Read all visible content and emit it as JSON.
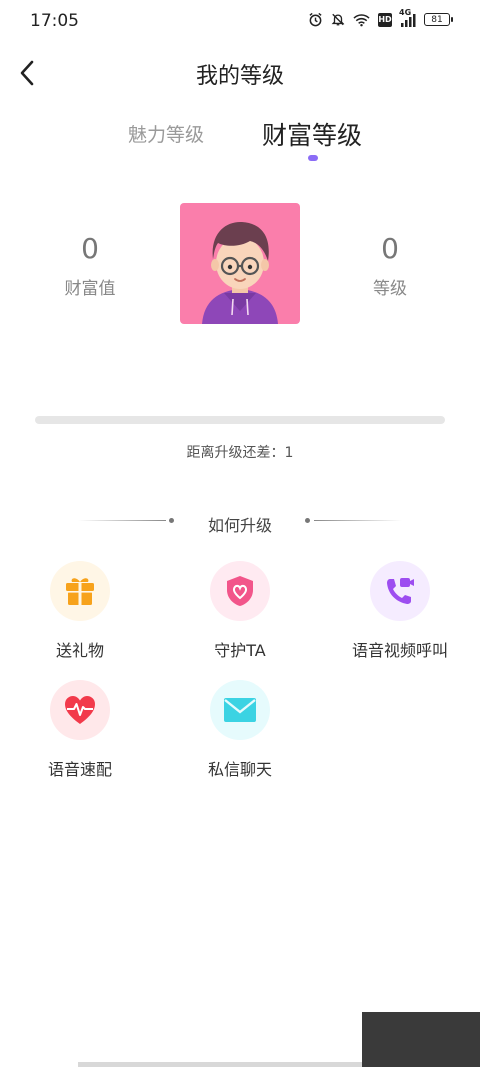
{
  "status_bar": {
    "time": "17:05",
    "network": "4G",
    "hd": "HD",
    "battery": "81"
  },
  "header": {
    "title": "我的等级",
    "back_icon": "chevron-left-icon"
  },
  "tabs": [
    {
      "label": "魅力等级",
      "active": false
    },
    {
      "label": "财富等级",
      "active": true
    }
  ],
  "accent_color": "#8b6cf6",
  "stats": {
    "wealth_value": "0",
    "wealth_label": "财富值",
    "level_value": "0",
    "level_label": "等级"
  },
  "progress": {
    "fraction": 0,
    "distance_text": "距离升级还差：1"
  },
  "how_to_upgrade": {
    "title": "如何升级",
    "items": [
      {
        "label": "送礼物",
        "icon": "gift-icon",
        "bg": "#fff6e6",
        "color": "#f7a21b"
      },
      {
        "label": "守护TA",
        "icon": "shield-heart-icon",
        "bg": "#ffeaf1",
        "color": "#f2558a"
      },
      {
        "label": "语音视频呼叫",
        "icon": "phone-video-icon",
        "bg": "#f5ecff",
        "color": "#9d4ef0"
      },
      {
        "label": "语音速配",
        "icon": "heartbeat-icon",
        "bg": "#ffe8ea",
        "color": "#f23a4b"
      },
      {
        "label": "私信聊天",
        "icon": "envelope-icon",
        "bg": "#e6fbfd",
        "color": "#3bd3e3"
      }
    ]
  }
}
